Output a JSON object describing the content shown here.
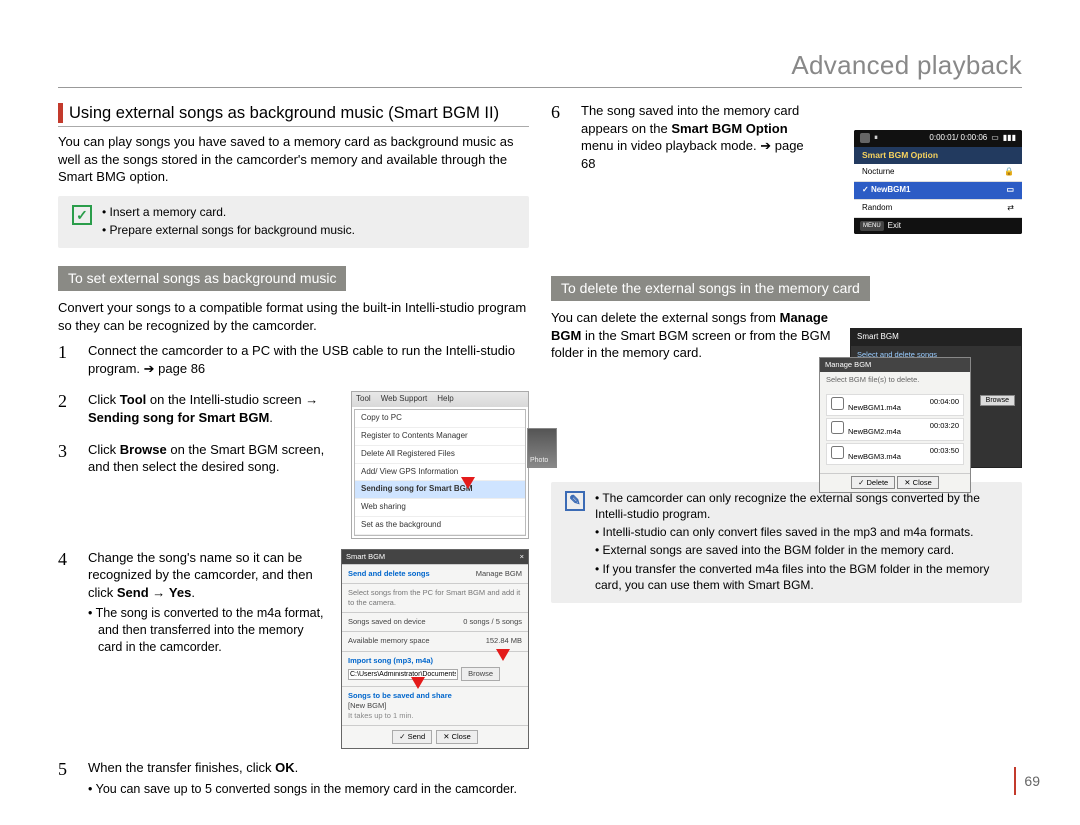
{
  "header": {
    "title": "Advanced playback"
  },
  "page_number": "69",
  "left": {
    "section_title": "Using external songs as background music (Smart BGM II)",
    "intro": "You can play songs you have saved to a memory card as background music as well as the songs stored in the camcorder's memory and available through the Smart BMG option.",
    "prep_notes": [
      "Insert a memory card.",
      "Prepare external songs for background music."
    ],
    "sub_head": "To set external songs as background music",
    "sub_intro": "Convert your songs to a compatible format using the built-in Intelli-studio program so they can be recognized by the camcorder.",
    "steps": {
      "s1": {
        "num": "1",
        "text_a": "Connect the camcorder to a PC with the USB cable to run the Intelli-studio program. ",
        "page_ref": "page 86"
      },
      "s2": {
        "num": "2",
        "text_a": "Click ",
        "bold_a": "Tool",
        "text_b": " on the Intelli-studio screen → ",
        "bold_b": "Sending song for Smart BGM",
        "text_c": "."
      },
      "s3": {
        "num": "3",
        "text_a": "Click ",
        "bold_a": "Browse",
        "text_b": " on the Smart BGM screen, and then select the desired song."
      },
      "s4": {
        "num": "4",
        "text_a": "Change the song's name so it can be recognized by the camcorder, and then click ",
        "bold_a": "Send",
        "arrow": " → ",
        "bold_b": "Yes",
        "text_b": ".",
        "bullet": "The song is converted to the m4a format, and then transferred into the memory card in the camcorder."
      },
      "s5": {
        "num": "5",
        "text_a": "When the transfer finishes, click ",
        "bold_a": "OK",
        "text_b": ".",
        "bullet": "You can save up to 5 converted songs in the memory card in the camcorder."
      }
    },
    "menu_shot": {
      "menubar": [
        "Tool",
        "Web Support",
        "Help"
      ],
      "rows": [
        "Copy to PC",
        "Register to Contents Manager",
        "Delete All Registered Files",
        "Add/ View GPS Information",
        "Sending song for Smart BGM",
        "Web sharing",
        "Set as the background"
      ],
      "side_label": "Photo"
    },
    "bgm_dialog": {
      "title": "Smart BGM",
      "head1": "Send and delete songs",
      "head1b": "Manage BGM",
      "desc": "Select songs from the PC for Smart BGM and add it to the camera.",
      "row_a": "Songs saved on device",
      "row_a_val": "0 songs / 5 songs",
      "row_b": "Available memory space",
      "row_b_val": "152.84 MB",
      "head2": "Import song (mp3, m4a)",
      "path": "C:\\Users\\Administrator\\Documents\\Music",
      "browse": "Browse",
      "head3": "Songs to be saved and share",
      "list_item": "[New BGM]",
      "list_sub": "It takes up to 1 min.",
      "send": "Send",
      "close": "Close"
    }
  },
  "right": {
    "step6": {
      "num": "6",
      "text_a": "The song saved into the memory card appears on the ",
      "bold_a": "Smart BGM Option",
      "text_b": " menu in video playback mode. ",
      "page_ref": "page 68"
    },
    "cam": {
      "time": "0:00:01/ 0:00:06",
      "title": "Smart BGM Option",
      "rows": [
        "Nocturne",
        "NewBGM1",
        "Random"
      ],
      "selected_index": 1,
      "exit": "Exit",
      "menu_btn": "MENU"
    },
    "sub_head": "To delete the external songs in the memory card",
    "delete_intro_a": "You can delete the external songs from ",
    "delete_bold": "Manage BGM",
    "delete_intro_b": " in the Smart BGM screen or from the BGM folder in the memory card.",
    "manage_shot": {
      "back_title": "Smart BGM",
      "back_head": "Select and delete songs",
      "front_title": "Manage BGM",
      "front_desc": "Select BGM file(s) to delete.",
      "rows": [
        {
          "name": "NewBGM1.m4a",
          "dur": "00:04:00"
        },
        {
          "name": "NewBGM2.m4a",
          "dur": "00:03:20"
        },
        {
          "name": "NewBGM3.m4a",
          "dur": "00:03:50"
        }
      ],
      "delete": "Delete",
      "close": "Close",
      "side_btn": "Browse"
    },
    "info_notes": [
      "The camcorder can only recognize the external songs converted by the Intelli-studio program.",
      "Intelli-studio can only convert files saved in the mp3 and m4a formats.",
      "External songs are saved into the BGM folder in the memory card.",
      "If you transfer the converted m4a files into the BGM folder in the memory card, you can use them with Smart BGM."
    ]
  }
}
